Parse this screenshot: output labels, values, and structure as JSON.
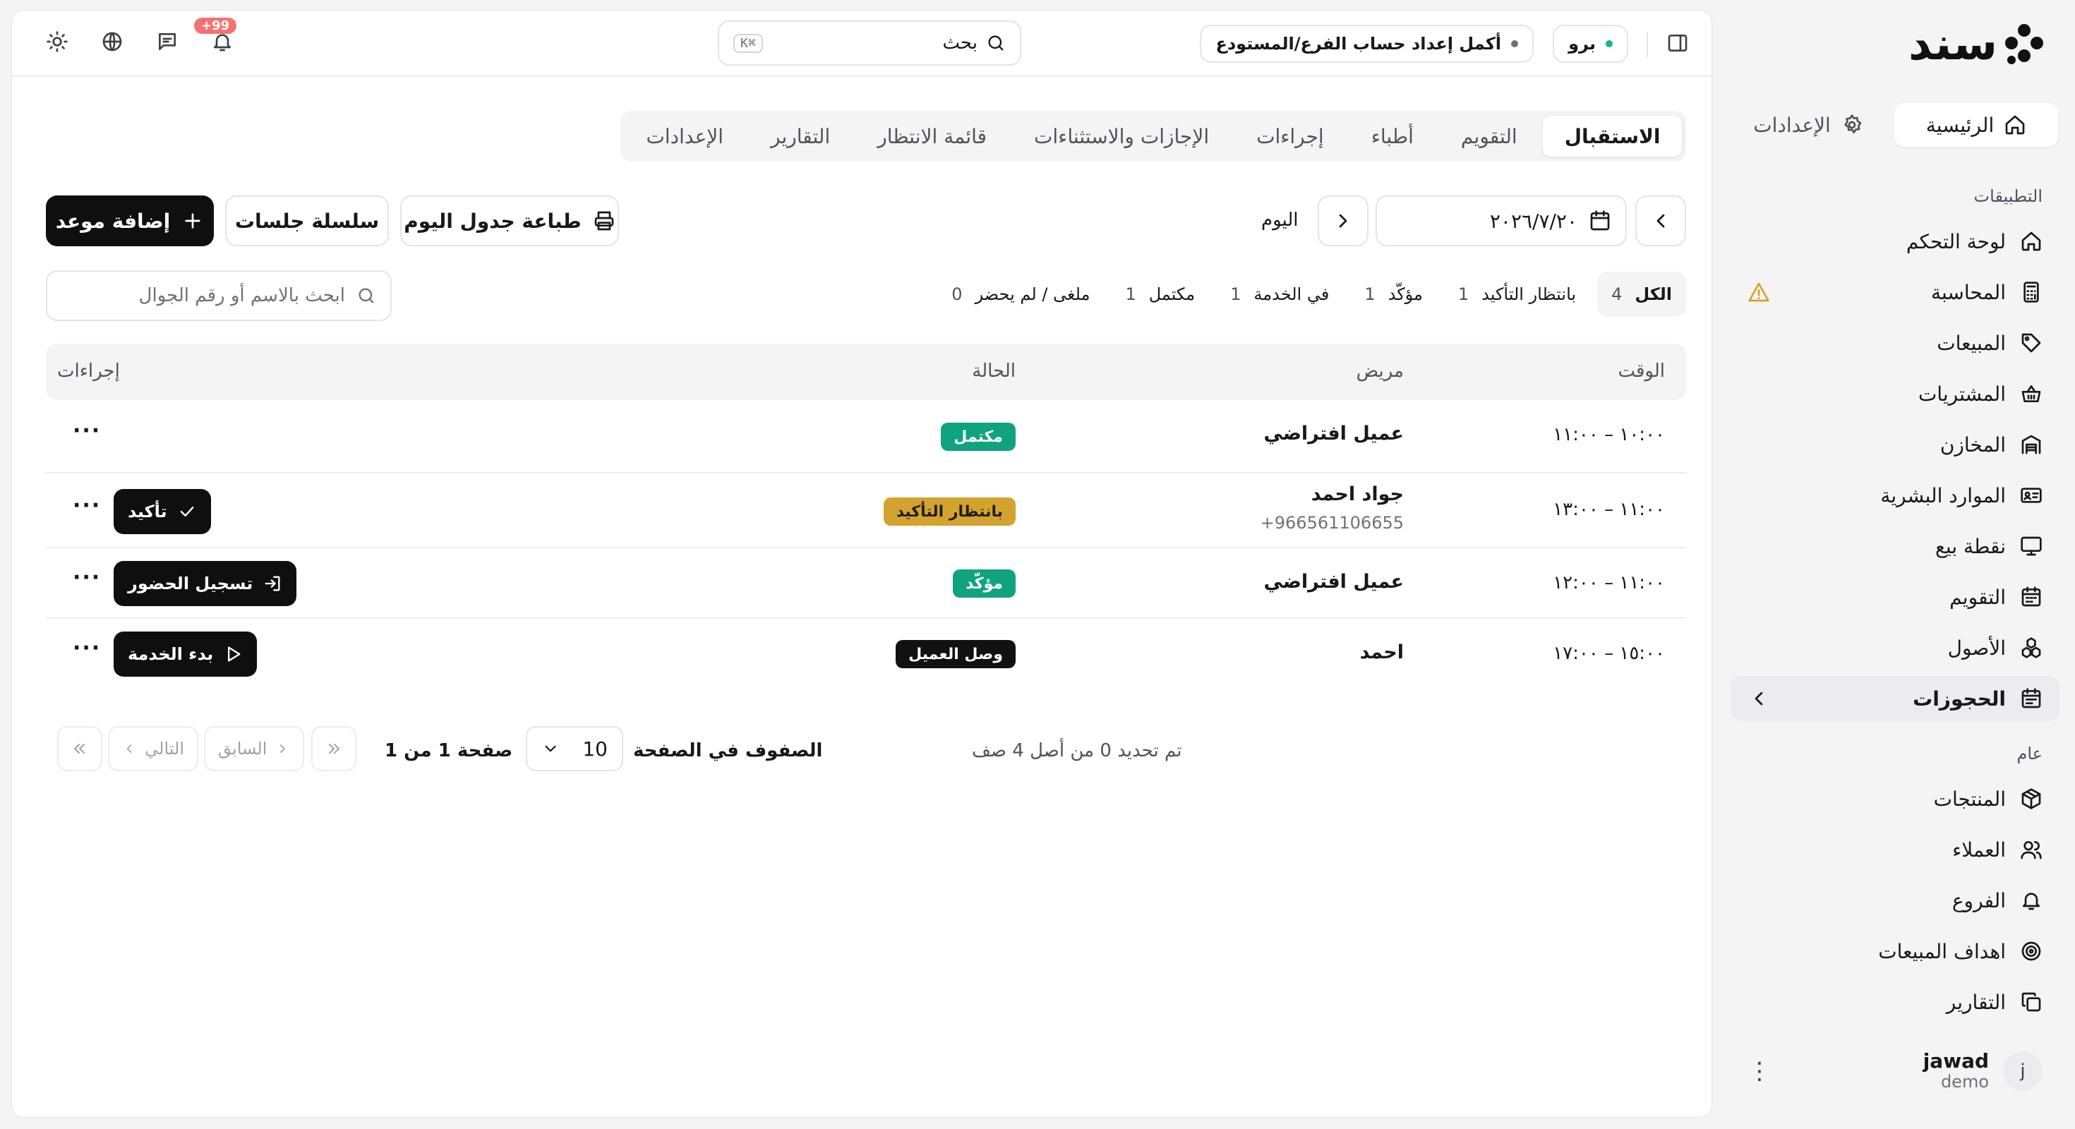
{
  "brand": {
    "logo_text": "سند"
  },
  "sidebar": {
    "top_tabs": [
      {
        "label": "الرئيسية",
        "icon": "home-icon",
        "active": true
      },
      {
        "label": "الإعدادات",
        "icon": "gear-icon",
        "active": false
      }
    ],
    "apps_label": "التطبيقات",
    "apps": [
      {
        "label": "لوحة التحكم",
        "icon": "home-icon"
      },
      {
        "label": "المحاسبة",
        "icon": "calculator-icon",
        "warning": true
      },
      {
        "label": "المبيعات",
        "icon": "tag-icon"
      },
      {
        "label": "المشتريات",
        "icon": "basket-icon"
      },
      {
        "label": "المخازن",
        "icon": "warehouse-icon"
      },
      {
        "label": "الموارد البشرية",
        "icon": "id-card-icon"
      },
      {
        "label": "نقطة بيع",
        "icon": "monitor-icon"
      },
      {
        "label": "التقويم",
        "icon": "calendar-icon"
      },
      {
        "label": "الأصول",
        "icon": "boxes-icon"
      },
      {
        "label": "الحجوزات",
        "icon": "calendar-check-icon",
        "active": true
      }
    ],
    "general_label": "عام",
    "general": [
      {
        "label": "المنتجات",
        "icon": "package-icon"
      },
      {
        "label": "العملاء",
        "icon": "users-icon"
      },
      {
        "label": "الفروع",
        "icon": "bell-icon"
      },
      {
        "label": "اهداف المبيعات",
        "icon": "target-icon"
      },
      {
        "label": "التقارير",
        "icon": "copy-icon"
      }
    ],
    "user": {
      "name": "jawad",
      "sub": "demo",
      "initial": "j"
    }
  },
  "header": {
    "plan_label": "برو",
    "plan_dot_color": "#10b981",
    "setup_label": "أكمل إعداد حساب الفرع/المستودع",
    "search_label": "بحث",
    "search_shortcut": "⌘K",
    "notifications_badge": "+99"
  },
  "module_tabs": [
    {
      "label": "الاستقبال",
      "active": true
    },
    {
      "label": "التقويم"
    },
    {
      "label": "أطباء"
    },
    {
      "label": "إجراءات"
    },
    {
      "label": "الإجازات والاستثناءات"
    },
    {
      "label": "قائمة الانتظار"
    },
    {
      "label": "التقارير"
    },
    {
      "label": "الإعدادات"
    }
  ],
  "toolbar": {
    "date_value": "٢٠٢٦/٧/٢٠",
    "today_label": "اليوم",
    "print_label": "طباعة جدول اليوم",
    "series_label": "سلسلة جلسات",
    "add_label": "إضافة موعد"
  },
  "filters": [
    {
      "label": "الكل",
      "count": "4",
      "active": true
    },
    {
      "label": "بانتظار التأكيد",
      "count": "1"
    },
    {
      "label": "مؤكّد",
      "count": "1"
    },
    {
      "label": "في الخدمة",
      "count": "1"
    },
    {
      "label": "مكتمل",
      "count": "1"
    },
    {
      "label": "ملغى / لم يحضر",
      "count": "0"
    }
  ],
  "table_search_placeholder": "ابحث بالاسم أو رقم الجوال",
  "table": {
    "headers": {
      "time": "الوقت",
      "patient": "مريض",
      "status": "الحالة",
      "actions": "إجراءات"
    },
    "rows": [
      {
        "time": "١٠:٠٠ – ١١:٠٠",
        "patient": "عميل افتراضي",
        "phone": "",
        "status": "مكتمل",
        "status_bg": "#10a37f",
        "status_fg": "#ffffff",
        "action": "",
        "action_icon": ""
      },
      {
        "time": "١١:٠٠ – ١٣:٠٠",
        "patient": "جواد احمد",
        "phone": "+966561106655",
        "status": "بانتظار التأكيد",
        "status_bg": "#d4a22e",
        "status_fg": "#1f1f1f",
        "action": "تأكيد",
        "action_icon": "check-icon"
      },
      {
        "time": "١١:٠٠ – ١٢:٠٠",
        "patient": "عميل افتراضي",
        "phone": "",
        "status": "مؤكّد",
        "status_bg": "#10a37f",
        "status_fg": "#ffffff",
        "action": "تسجيل الحضور",
        "action_icon": "login-icon"
      },
      {
        "time": "١٥:٠٠ – ١٧:٠٠",
        "patient": "احمد",
        "phone": "",
        "status": "وصل العميل",
        "status_bg": "#111111",
        "status_fg": "#ffffff",
        "action": "بدء الخدمة",
        "action_icon": "play-icon"
      }
    ]
  },
  "pagination": {
    "selected_text": "تم تحديد 0 من أصل 4 صف",
    "rows_per_page_label": "الصفوف في الصفحة",
    "rows_per_page_value": "10",
    "page_text": "صفحة 1 من 1",
    "prev_label": "السابق",
    "next_label": "التالي"
  }
}
